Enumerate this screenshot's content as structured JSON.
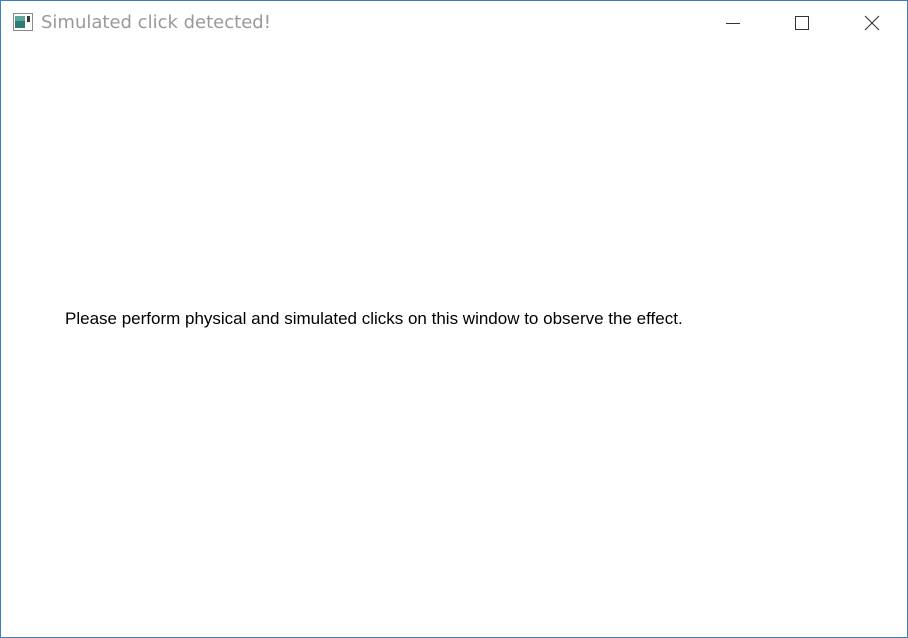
{
  "window": {
    "title": "Simulated click detected!",
    "icon": "app-window-icon",
    "controls": {
      "minimize_icon": "minimize-icon",
      "maximize_icon": "maximize-icon",
      "close_icon": "close-icon"
    },
    "border_color": "#3f7fbf",
    "title_color": "#999999"
  },
  "content": {
    "message": "Please perform physical and simulated clicks on this window to observe the effect."
  }
}
